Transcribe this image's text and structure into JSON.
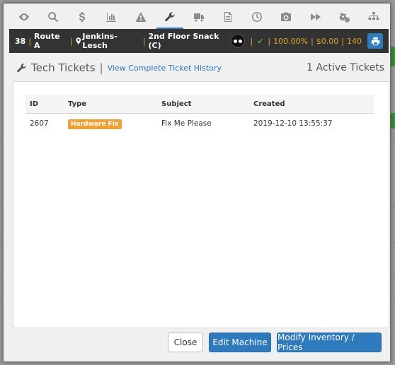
{
  "tabs": [
    {
      "name": "eye-icon"
    },
    {
      "name": "search-icon"
    },
    {
      "name": "dollar-icon"
    },
    {
      "name": "bar-chart-icon"
    },
    {
      "name": "warning-icon"
    },
    {
      "name": "wrench-icon",
      "active": true
    },
    {
      "name": "truck-icon"
    },
    {
      "name": "document-icon"
    },
    {
      "name": "clock-icon"
    },
    {
      "name": "camera-icon"
    },
    {
      "name": "fast-forward-icon"
    },
    {
      "name": "gears-icon"
    },
    {
      "name": "sitemap-icon"
    }
  ],
  "infobar": {
    "machine_id": "38",
    "route": "Route A",
    "location": "Jenkins-Lesch",
    "machine_name": "2nd Floor Snack (C)",
    "percent": "100.00%",
    "amount": "$0.00",
    "count": "140"
  },
  "heading": {
    "title": "Tech Tickets",
    "history_link": "View Complete Ticket History",
    "active_count": "1 Active Tickets"
  },
  "table": {
    "columns": [
      "ID",
      "Type",
      "Subject",
      "Created"
    ],
    "rows": [
      {
        "id": "2607",
        "type": "Hardware Fix",
        "subject": "Fix Me Please",
        "created": "2019-12-10 13:55:37"
      }
    ]
  },
  "footer": {
    "close_label": "Close",
    "edit_label": "Edit Machine",
    "modify_label": "Modify Inventory / Prices"
  },
  "colors": {
    "accent": "#2f79bd",
    "badge": "#f0a135",
    "infobar_bg": "#333333",
    "highlight": "#e0a526"
  }
}
